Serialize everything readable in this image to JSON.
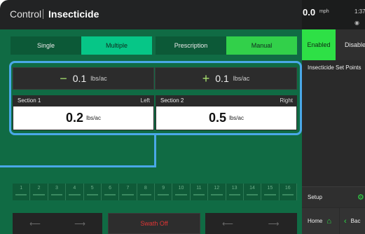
{
  "header": {
    "control": "Control",
    "page": "Insecticide"
  },
  "status": {
    "speed": "0.0",
    "speed_unit": "mph",
    "time": "1:37"
  },
  "modes": {
    "single": "Single",
    "multiple": "Multiple",
    "prescription": "Prescription",
    "manual": "Manual"
  },
  "adjust": {
    "minus_symbol": "−",
    "minus_value": "0.1",
    "plus_symbol": "+",
    "plus_value": "0.1",
    "unit": "lbs/ac"
  },
  "sections": [
    {
      "name": "Section 1",
      "side": "Left",
      "value": "0.2",
      "unit": "lbs/ac"
    },
    {
      "name": "Section 2",
      "side": "Right",
      "value": "0.5",
      "unit": "lbs/ac"
    }
  ],
  "section_bar": [
    "1",
    "2",
    "3",
    "4",
    "5",
    "6",
    "7",
    "8",
    "9",
    "10",
    "11",
    "12",
    "13",
    "14",
    "15",
    "16"
  ],
  "bottom": {
    "swath": "Swath Off",
    "arrow_left": "⟵",
    "arrow_right": "⟶"
  },
  "right_panel": {
    "enabled": "Enabled",
    "disabled": "Disable",
    "setpoints": "Insecticide Set Points",
    "setup": "Setup",
    "home": "Home",
    "back": "Bac"
  },
  "colors": {
    "main_bg": "#106b44",
    "selected_mode": "#06c687",
    "manual": "#32d04a",
    "enabled": "#2ee046",
    "highlight": "#4aa8e8",
    "swath_off": "#e03535"
  }
}
